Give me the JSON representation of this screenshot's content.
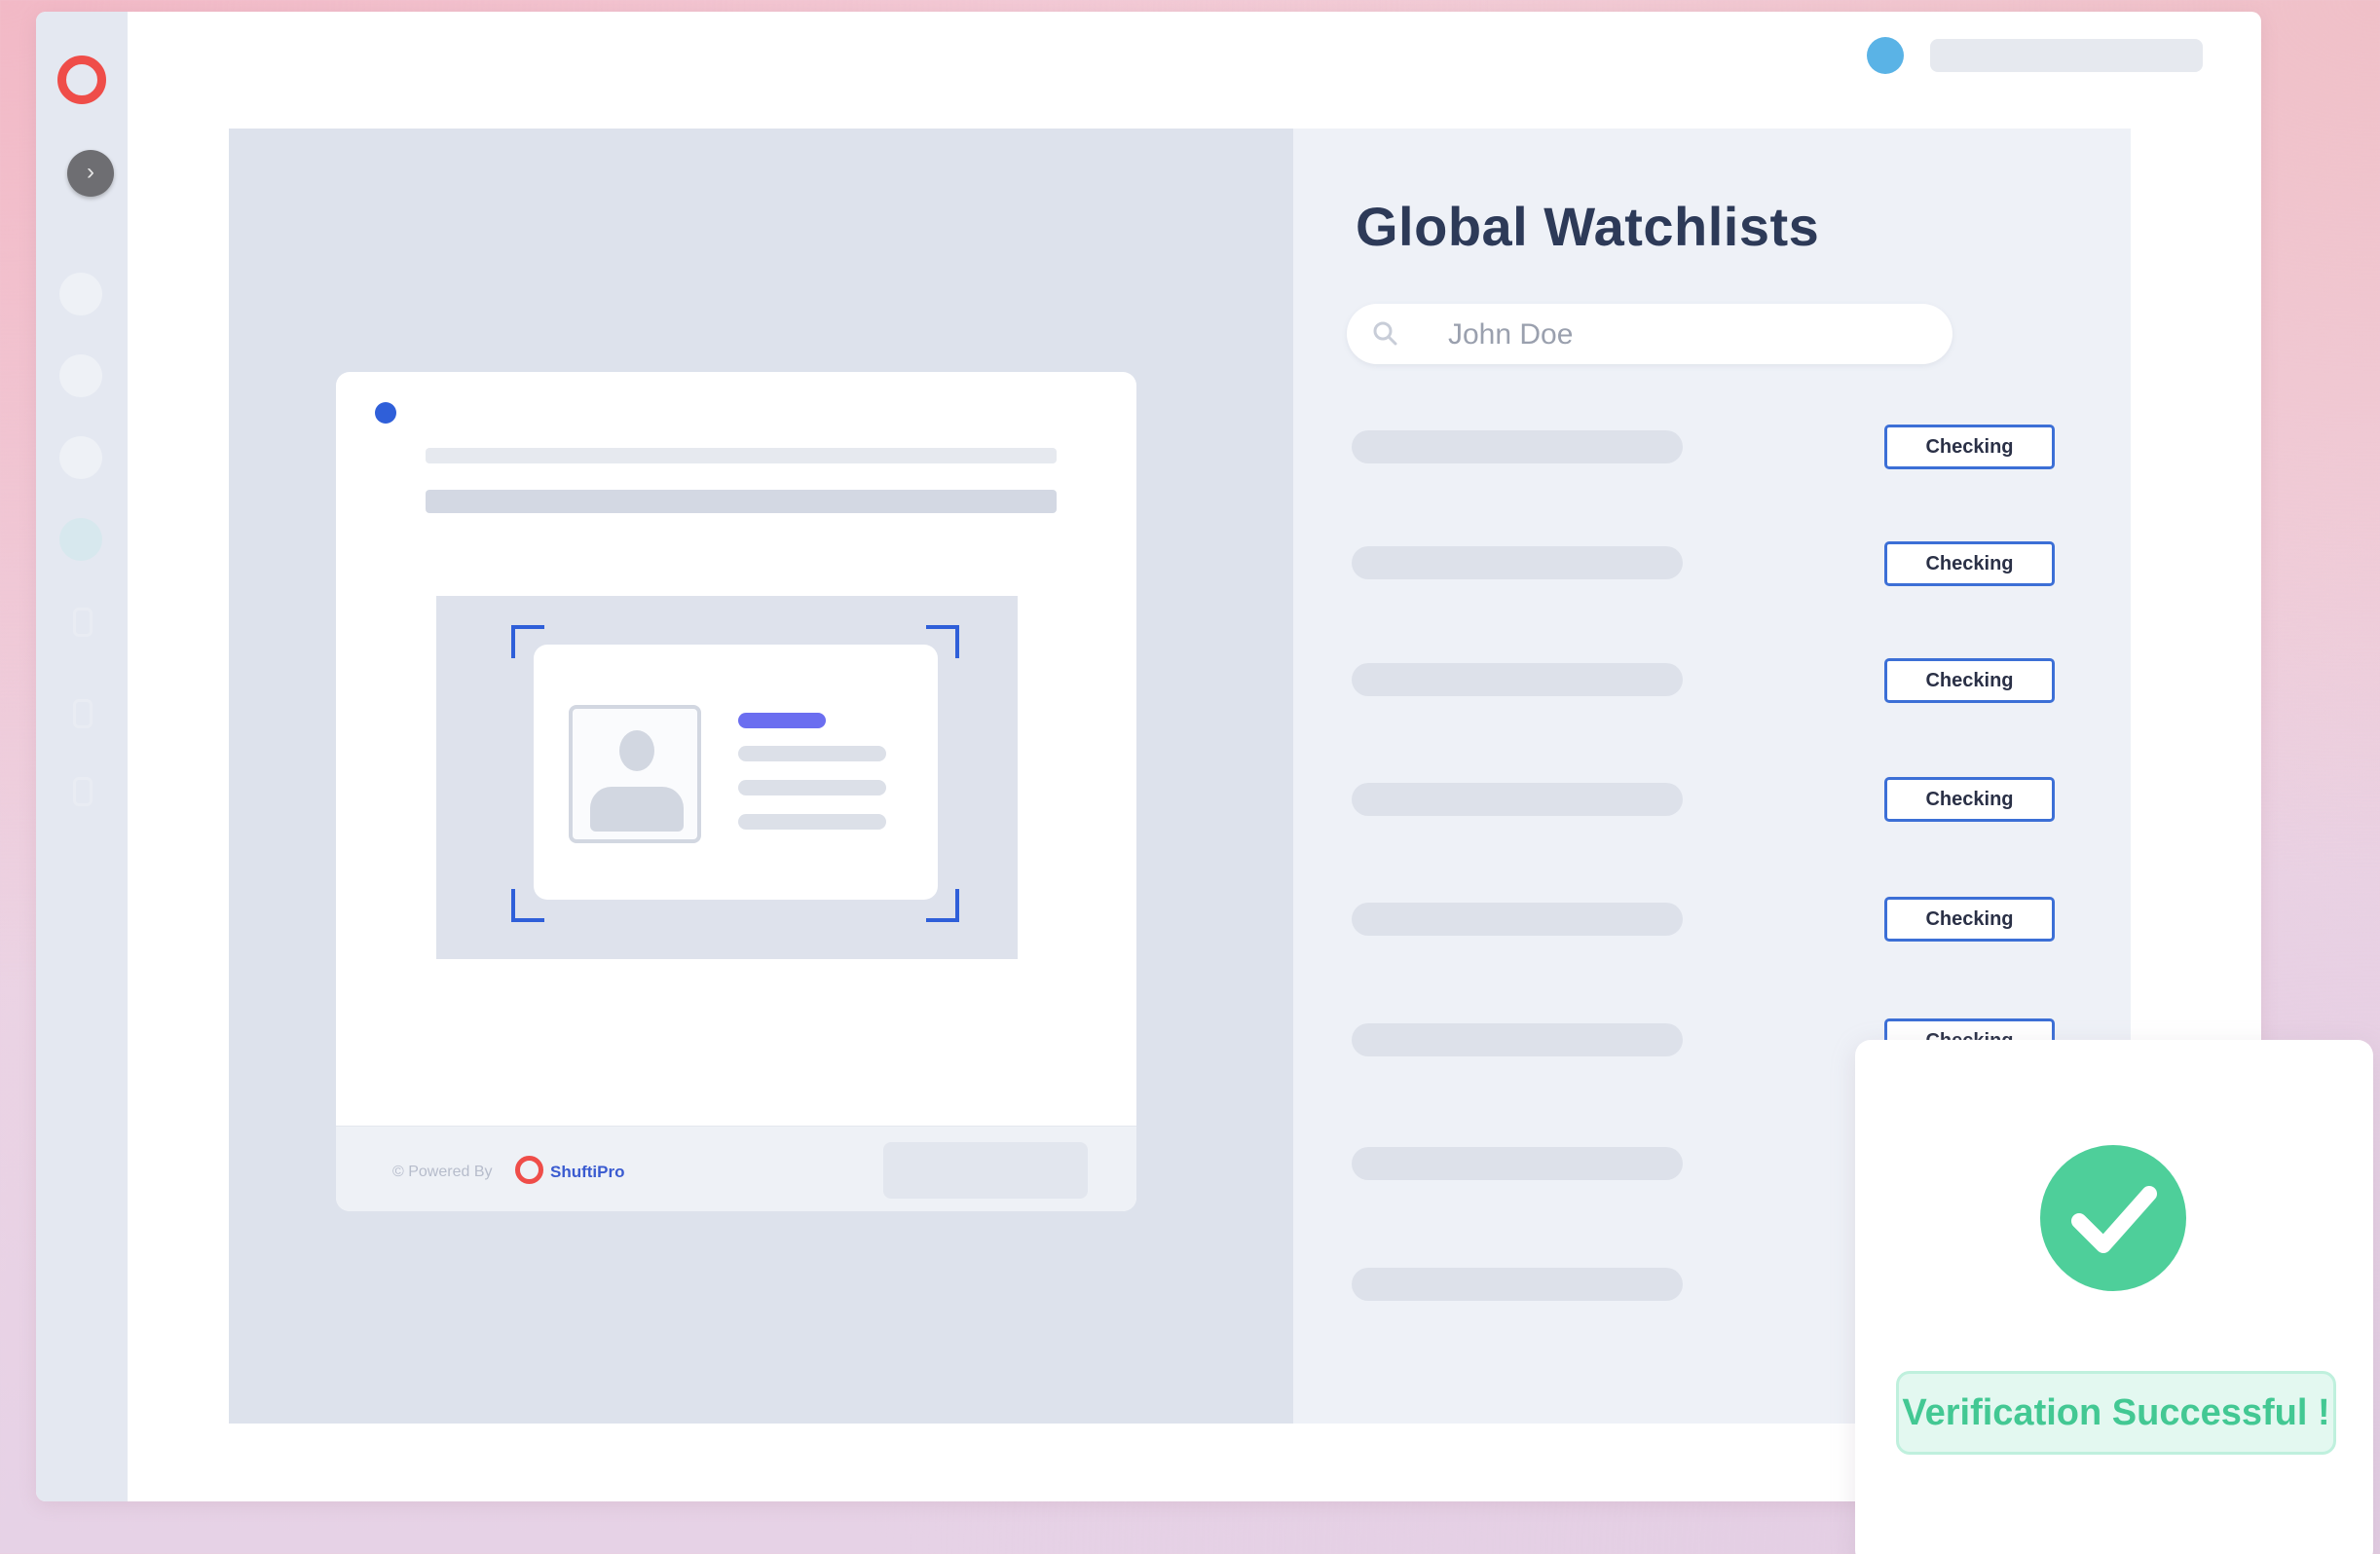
{
  "page": {
    "title": "Global Watchlists",
    "search": {
      "value": "John Doe",
      "icon": "search-icon"
    }
  },
  "sidebar": {
    "logo": "shuftipro-logo-icon",
    "expand_icon": "chevron-right-icon",
    "expand_glyph": "›"
  },
  "card": {
    "footer": {
      "powered_by": "© Powered By",
      "brand": "ShuftiPro"
    }
  },
  "watchlist": {
    "rows": [
      {
        "status": "Checking"
      },
      {
        "status": "Checking"
      },
      {
        "status": "Checking"
      },
      {
        "status": "Checking"
      },
      {
        "status": "Checking"
      },
      {
        "status": "Checking"
      },
      {
        "status": ""
      },
      {
        "status": ""
      }
    ]
  },
  "success": {
    "message": "Verification Successful !",
    "icon": "checkmark-icon"
  },
  "colors": {
    "brand_red": "#ef4d49",
    "accent_blue": "#2f5fd9",
    "success_green": "#4ecf9a"
  }
}
